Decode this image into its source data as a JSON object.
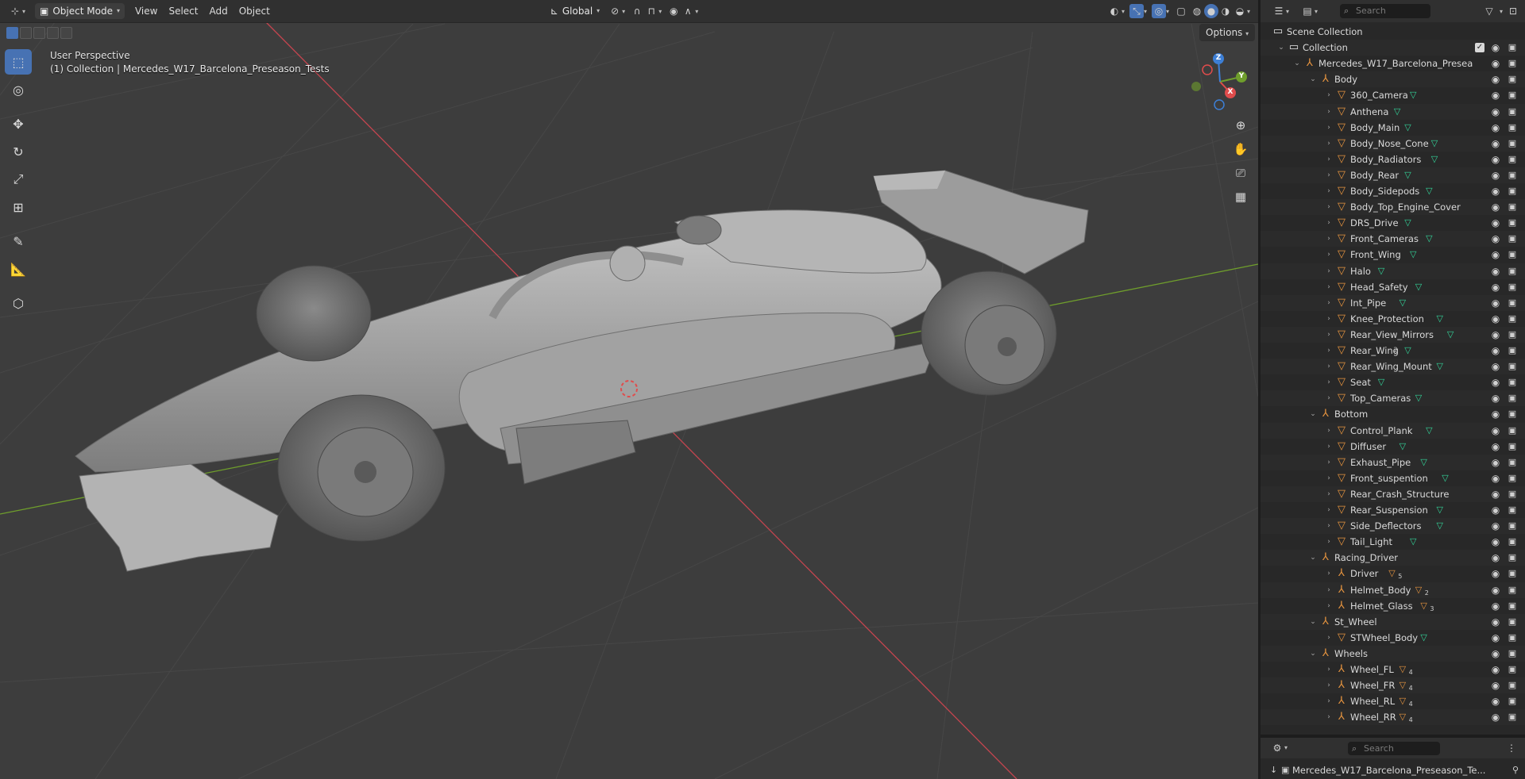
{
  "viewport": {
    "mode_label": "Object Mode",
    "menus": [
      "View",
      "Select",
      "Add",
      "Object"
    ],
    "orientation_label": "Global",
    "perspective_label": "User Perspective",
    "collection_info": "(1) Collection | Mercedes_W17_Barcelona_Preseason_Tests",
    "options_label": "Options",
    "gizmo_axes": [
      "X",
      "Y",
      "Z"
    ],
    "colors": {
      "background": "#3d3d3d",
      "grid": "#474747",
      "x_axis": "#c4454f",
      "y_axis": "#6f9e2c",
      "active_tool": "#4772b3",
      "car": "#a9a9a9"
    }
  },
  "outliner": {
    "search_placeholder": "Search",
    "colors": {
      "collection_icon": "#e8e8e8",
      "object_icon": "#e6943f",
      "modifier_icon": "#33d59a"
    },
    "rows": [
      {
        "label": "Scene Collection",
        "depth": 0,
        "icon": "scene-collection",
        "expanded": true,
        "type": "scene"
      },
      {
        "label": "Collection",
        "depth": 1,
        "icon": "collection",
        "expanded": true,
        "type": "collection"
      },
      {
        "label": "Mercedes_W17_Barcelona_Presea",
        "depth": 2,
        "icon": "empty",
        "expanded": true,
        "type": "object"
      },
      {
        "label": "Body",
        "depth": 3,
        "icon": "empty",
        "expanded": true,
        "type": "object"
      },
      {
        "label": "360_Camera",
        "depth": 4,
        "icon": "mesh",
        "expanded": false,
        "type": "object",
        "mod": "mesh-data"
      },
      {
        "label": "Anthena",
        "depth": 4,
        "icon": "mesh",
        "expanded": false,
        "type": "object",
        "mod": "mesh-data"
      },
      {
        "label": "Body_Main",
        "depth": 4,
        "icon": "mesh",
        "expanded": false,
        "type": "object",
        "mod": "mesh-data"
      },
      {
        "label": "Body_Nose_Cone",
        "depth": 4,
        "icon": "mesh",
        "expanded": false,
        "type": "object",
        "mod": "mesh-data"
      },
      {
        "label": "Body_Radiators",
        "depth": 4,
        "icon": "mesh",
        "expanded": false,
        "type": "object",
        "mod": "mesh-data"
      },
      {
        "label": "Body_Rear",
        "depth": 4,
        "icon": "mesh",
        "expanded": false,
        "type": "object",
        "mod": "mesh-data"
      },
      {
        "label": "Body_Sidepods",
        "depth": 4,
        "icon": "mesh",
        "expanded": false,
        "type": "object",
        "mod": "mesh-data"
      },
      {
        "label": "Body_Top_Engine_Cover",
        "depth": 4,
        "icon": "mesh",
        "expanded": false,
        "type": "object"
      },
      {
        "label": "DRS_Drive",
        "depth": 4,
        "icon": "mesh",
        "expanded": false,
        "type": "object",
        "mod": "mesh-data"
      },
      {
        "label": "Front_Cameras",
        "depth": 4,
        "icon": "mesh",
        "expanded": false,
        "type": "object",
        "mod": "mesh-data"
      },
      {
        "label": "Front_Wing",
        "depth": 4,
        "icon": "mesh",
        "expanded": false,
        "type": "object",
        "mod": "mesh-data"
      },
      {
        "label": "Halo",
        "depth": 4,
        "icon": "mesh",
        "expanded": false,
        "type": "object",
        "mod": "mesh-data"
      },
      {
        "label": "Head_Safety",
        "depth": 4,
        "icon": "mesh",
        "expanded": false,
        "type": "object",
        "mod": "mesh-data"
      },
      {
        "label": "Int_Pipe",
        "depth": 4,
        "icon": "mesh",
        "expanded": false,
        "type": "object",
        "mod": "mesh-data"
      },
      {
        "label": "Knee_Protection",
        "depth": 4,
        "icon": "mesh",
        "expanded": false,
        "type": "object",
        "mod": "mesh-data"
      },
      {
        "label": "Rear_View_Mirrors",
        "depth": 4,
        "icon": "mesh",
        "expanded": false,
        "type": "object",
        "mod": "mesh-data"
      },
      {
        "label": "Rear_Wing",
        "depth": 4,
        "icon": "mesh",
        "expanded": false,
        "type": "object",
        "mod": "mesh-data",
        "extra": "2"
      },
      {
        "label": "Rear_Wing_Mount",
        "depth": 4,
        "icon": "mesh",
        "expanded": false,
        "type": "object",
        "mod": "mesh-data"
      },
      {
        "label": "Seat",
        "depth": 4,
        "icon": "mesh",
        "expanded": false,
        "type": "object",
        "mod": "mesh-data"
      },
      {
        "label": "Top_Cameras",
        "depth": 4,
        "icon": "mesh",
        "expanded": false,
        "type": "object",
        "mod": "mesh-data"
      },
      {
        "label": "Bottom",
        "depth": 3,
        "icon": "empty",
        "expanded": true,
        "type": "object"
      },
      {
        "label": "Control_Plank",
        "depth": 4,
        "icon": "mesh",
        "expanded": false,
        "type": "object",
        "mod": "mesh-data"
      },
      {
        "label": "Diffuser",
        "depth": 4,
        "icon": "mesh",
        "expanded": false,
        "type": "object",
        "mod": "mesh-data"
      },
      {
        "label": "Exhaust_Pipe",
        "depth": 4,
        "icon": "mesh",
        "expanded": false,
        "type": "object",
        "mod": "mesh-data"
      },
      {
        "label": "Front_suspention",
        "depth": 4,
        "icon": "mesh",
        "expanded": false,
        "type": "object",
        "mod": "mesh-data"
      },
      {
        "label": "Rear_Crash_Structure",
        "depth": 4,
        "icon": "mesh",
        "expanded": false,
        "type": "object"
      },
      {
        "label": "Rear_Suspension",
        "depth": 4,
        "icon": "mesh",
        "expanded": false,
        "type": "object",
        "mod": "mesh-data"
      },
      {
        "label": "Side_Deflectors",
        "depth": 4,
        "icon": "mesh",
        "expanded": false,
        "type": "object",
        "mod": "mesh-data"
      },
      {
        "label": "Tail_Light",
        "depth": 4,
        "icon": "mesh",
        "expanded": false,
        "type": "object",
        "mod": "mesh-data"
      },
      {
        "label": "Racing_Driver",
        "depth": 3,
        "icon": "empty",
        "expanded": true,
        "type": "object"
      },
      {
        "label": "Driver",
        "depth": 4,
        "icon": "empty",
        "expanded": false,
        "type": "object",
        "child_count": "5"
      },
      {
        "label": "Helmet_Body",
        "depth": 4,
        "icon": "empty",
        "expanded": false,
        "type": "object",
        "child_count": "2"
      },
      {
        "label": "Helmet_Glass",
        "depth": 4,
        "icon": "empty",
        "expanded": false,
        "type": "object",
        "child_count": "3"
      },
      {
        "label": "St_Wheel",
        "depth": 3,
        "icon": "empty",
        "expanded": true,
        "type": "object"
      },
      {
        "label": "STWheel_Body",
        "depth": 4,
        "icon": "mesh",
        "expanded": false,
        "type": "object",
        "mod": "mesh-data"
      },
      {
        "label": "Wheels",
        "depth": 3,
        "icon": "empty",
        "expanded": true,
        "type": "object"
      },
      {
        "label": "Wheel_FL",
        "depth": 4,
        "icon": "empty",
        "expanded": false,
        "type": "object",
        "child_count": "4"
      },
      {
        "label": "Wheel_FR",
        "depth": 4,
        "icon": "empty",
        "expanded": false,
        "type": "object",
        "child_count": "4"
      },
      {
        "label": "Wheel_RL",
        "depth": 4,
        "icon": "empty",
        "expanded": false,
        "type": "object",
        "child_count": "4"
      },
      {
        "label": "Wheel_RR",
        "depth": 4,
        "icon": "empty",
        "expanded": false,
        "type": "object",
        "child_count": "4"
      }
    ]
  },
  "properties": {
    "search_placeholder": "Search",
    "object_name": "Mercedes_W17_Barcelona_Preseason_Te..."
  }
}
